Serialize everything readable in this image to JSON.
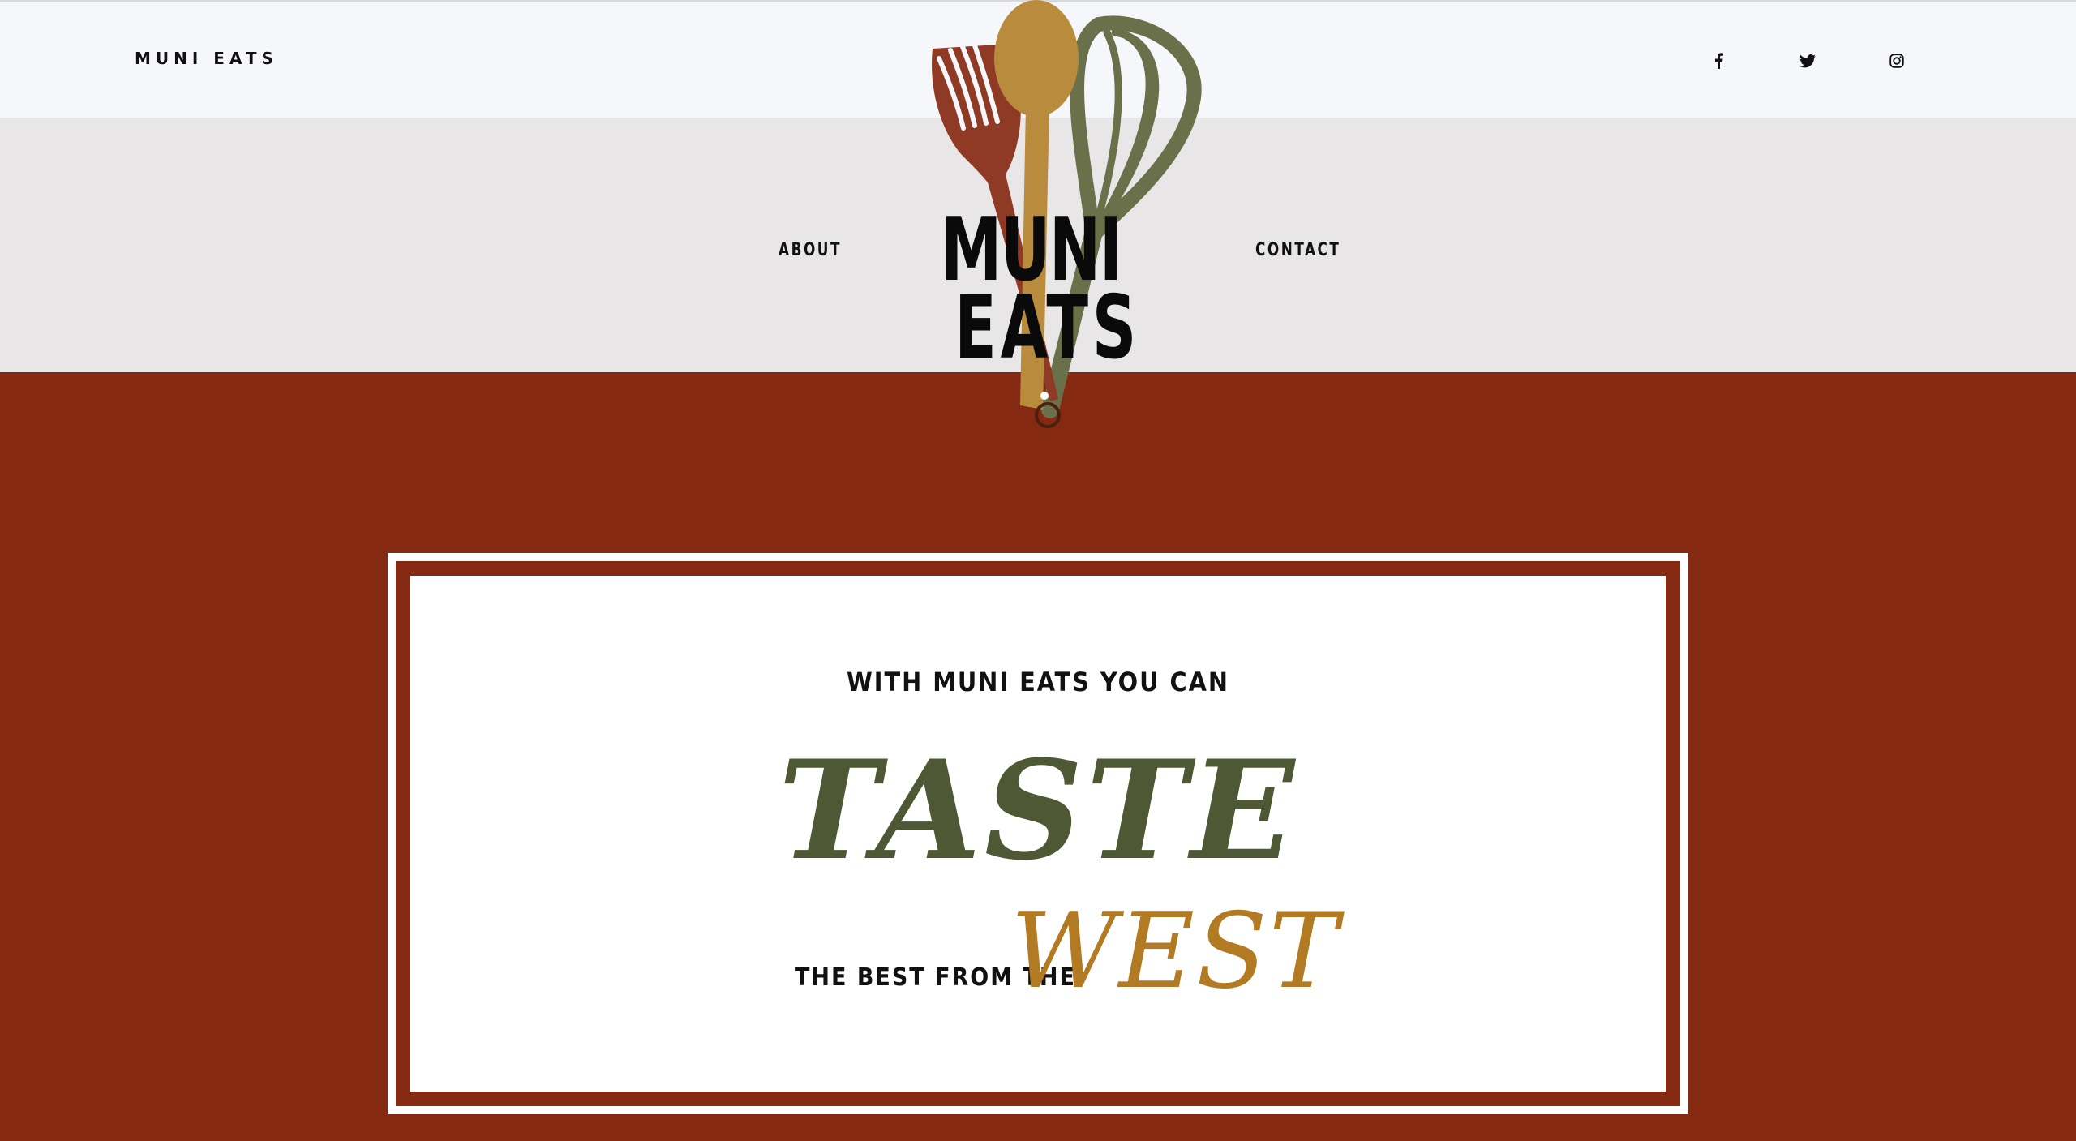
{
  "header": {
    "brand": "MUNI EATS",
    "social": [
      {
        "icon": "facebook-icon"
      },
      {
        "icon": "twitter-icon"
      },
      {
        "icon": "instagram-icon"
      }
    ]
  },
  "nav": {
    "left": "ABOUT",
    "right": "CONTACT"
  },
  "logo": {
    "line1": "MUNI",
    "line2": "EATS"
  },
  "hero": {
    "kicker": "WITH MUNI EATS YOU CAN",
    "headline": "TASTE",
    "tagline_small": "THE BEST FROM THE",
    "tagline_big": "WEST"
  },
  "colors": {
    "topbar": "#F6F7FA",
    "navband": "#E8E6E7",
    "brand_red": "#852912",
    "olive": "#4F5834",
    "mustard": "#B27A22",
    "fork": "#8E3A24",
    "spoon": "#B98B3C",
    "whisk": "#6A7049"
  }
}
